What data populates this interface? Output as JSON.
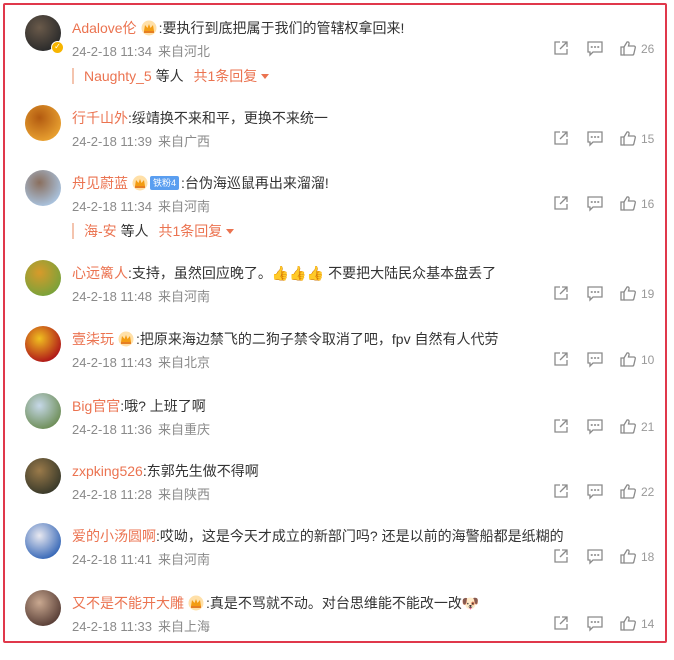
{
  "comments": [
    {
      "username": "Adalove伦",
      "crown": true,
      "fan_badge": "",
      "text": ":要执行到底把属于我们的管辖权拿回来!",
      "emoji": "",
      "time": "24-2-18 11:34",
      "location": "来自河北",
      "likes": "26",
      "verified": true,
      "reply": {
        "name": "Naughty_5",
        "others": "等人",
        "count": "共1条回复"
      },
      "avatar_colors": [
        "#2b2b2b",
        "#6a5a4a"
      ]
    },
    {
      "username": "行千山外",
      "crown": false,
      "fan_badge": "",
      "text": ":绥靖换不来和平，更换不来统一",
      "emoji": "",
      "time": "24-2-18 11:39",
      "location": "来自广西",
      "likes": "15",
      "verified": false,
      "reply": null,
      "avatar_colors": [
        "#e8a030",
        "#b25a10"
      ]
    },
    {
      "username": "舟见蔚蓝",
      "crown": true,
      "fan_badge": "铁粉4",
      "text": ":台伪海巡鼠再出来溜溜!",
      "emoji": "",
      "time": "24-2-18 11:34",
      "location": "来自河南",
      "likes": "16",
      "verified": false,
      "reply": {
        "name": "海-安",
        "others": "等人",
        "count": "共1条回复"
      },
      "avatar_colors": [
        "#a9c2dd",
        "#8a6f5e"
      ]
    },
    {
      "username": "心远篱人",
      "crown": false,
      "fan_badge": "",
      "text": ":支持，虽然回应晚了。",
      "emoji": "👍👍👍 不要把大陆民众基本盘丢了",
      "time": "24-2-18 11:48",
      "location": "来自河南",
      "likes": "19",
      "verified": false,
      "reply": null,
      "avatar_colors": [
        "#7aa23a",
        "#d89a2a"
      ]
    },
    {
      "username": "壹柒玩",
      "crown": true,
      "fan_badge": "",
      "text": ":把原来海边禁飞的二狗子禁令取消了吧，fpv 自然有人代劳",
      "emoji": "",
      "time": "24-2-18 11:43",
      "location": "来自北京",
      "likes": "10",
      "verified": false,
      "reply": null,
      "avatar_colors": [
        "#b01818",
        "#f0c020"
      ]
    },
    {
      "username": "Big官官",
      "crown": false,
      "fan_badge": "",
      "text": ":哦? 上班了啊",
      "emoji": "",
      "time": "24-2-18 11:36",
      "location": "来自重庆",
      "likes": "21",
      "verified": false,
      "reply": null,
      "avatar_colors": [
        "#6f8f5a",
        "#c6d8e8"
      ]
    },
    {
      "username": "zxpking526",
      "crown": false,
      "fan_badge": "",
      "text": ":东郭先生做不得啊",
      "emoji": "",
      "time": "24-2-18 11:28",
      "location": "来自陕西",
      "likes": "22",
      "verified": false,
      "reply": null,
      "avatar_colors": [
        "#3a3a2a",
        "#9a7a4a"
      ]
    },
    {
      "username": "爱的小汤圆啊",
      "crown": false,
      "fan_badge": "",
      "text": ":哎呦，这是今天才成立的新部门吗? 还是以前的海警船都是纸糊的",
      "emoji": "",
      "time": "24-2-18 11:41",
      "location": "来自河南",
      "likes": "18",
      "verified": false,
      "reply": null,
      "avatar_colors": [
        "#3a6ab8",
        "#e8e8f0"
      ]
    },
    {
      "username": "又不是不能开大雕",
      "crown": true,
      "fan_badge": "",
      "text": ":真是不骂就不动。对台思维能不能改一改",
      "emoji": "🐶",
      "time": "24-2-18 11:33",
      "location": "来自上海",
      "likes": "14",
      "verified": false,
      "reply": null,
      "avatar_colors": [
        "#5a4038",
        "#c9a890"
      ]
    }
  ],
  "colors": {
    "border": "#e0384b",
    "username": "#eb7350",
    "meta": "#8a8a8a",
    "icon": "#8a8a8a"
  }
}
